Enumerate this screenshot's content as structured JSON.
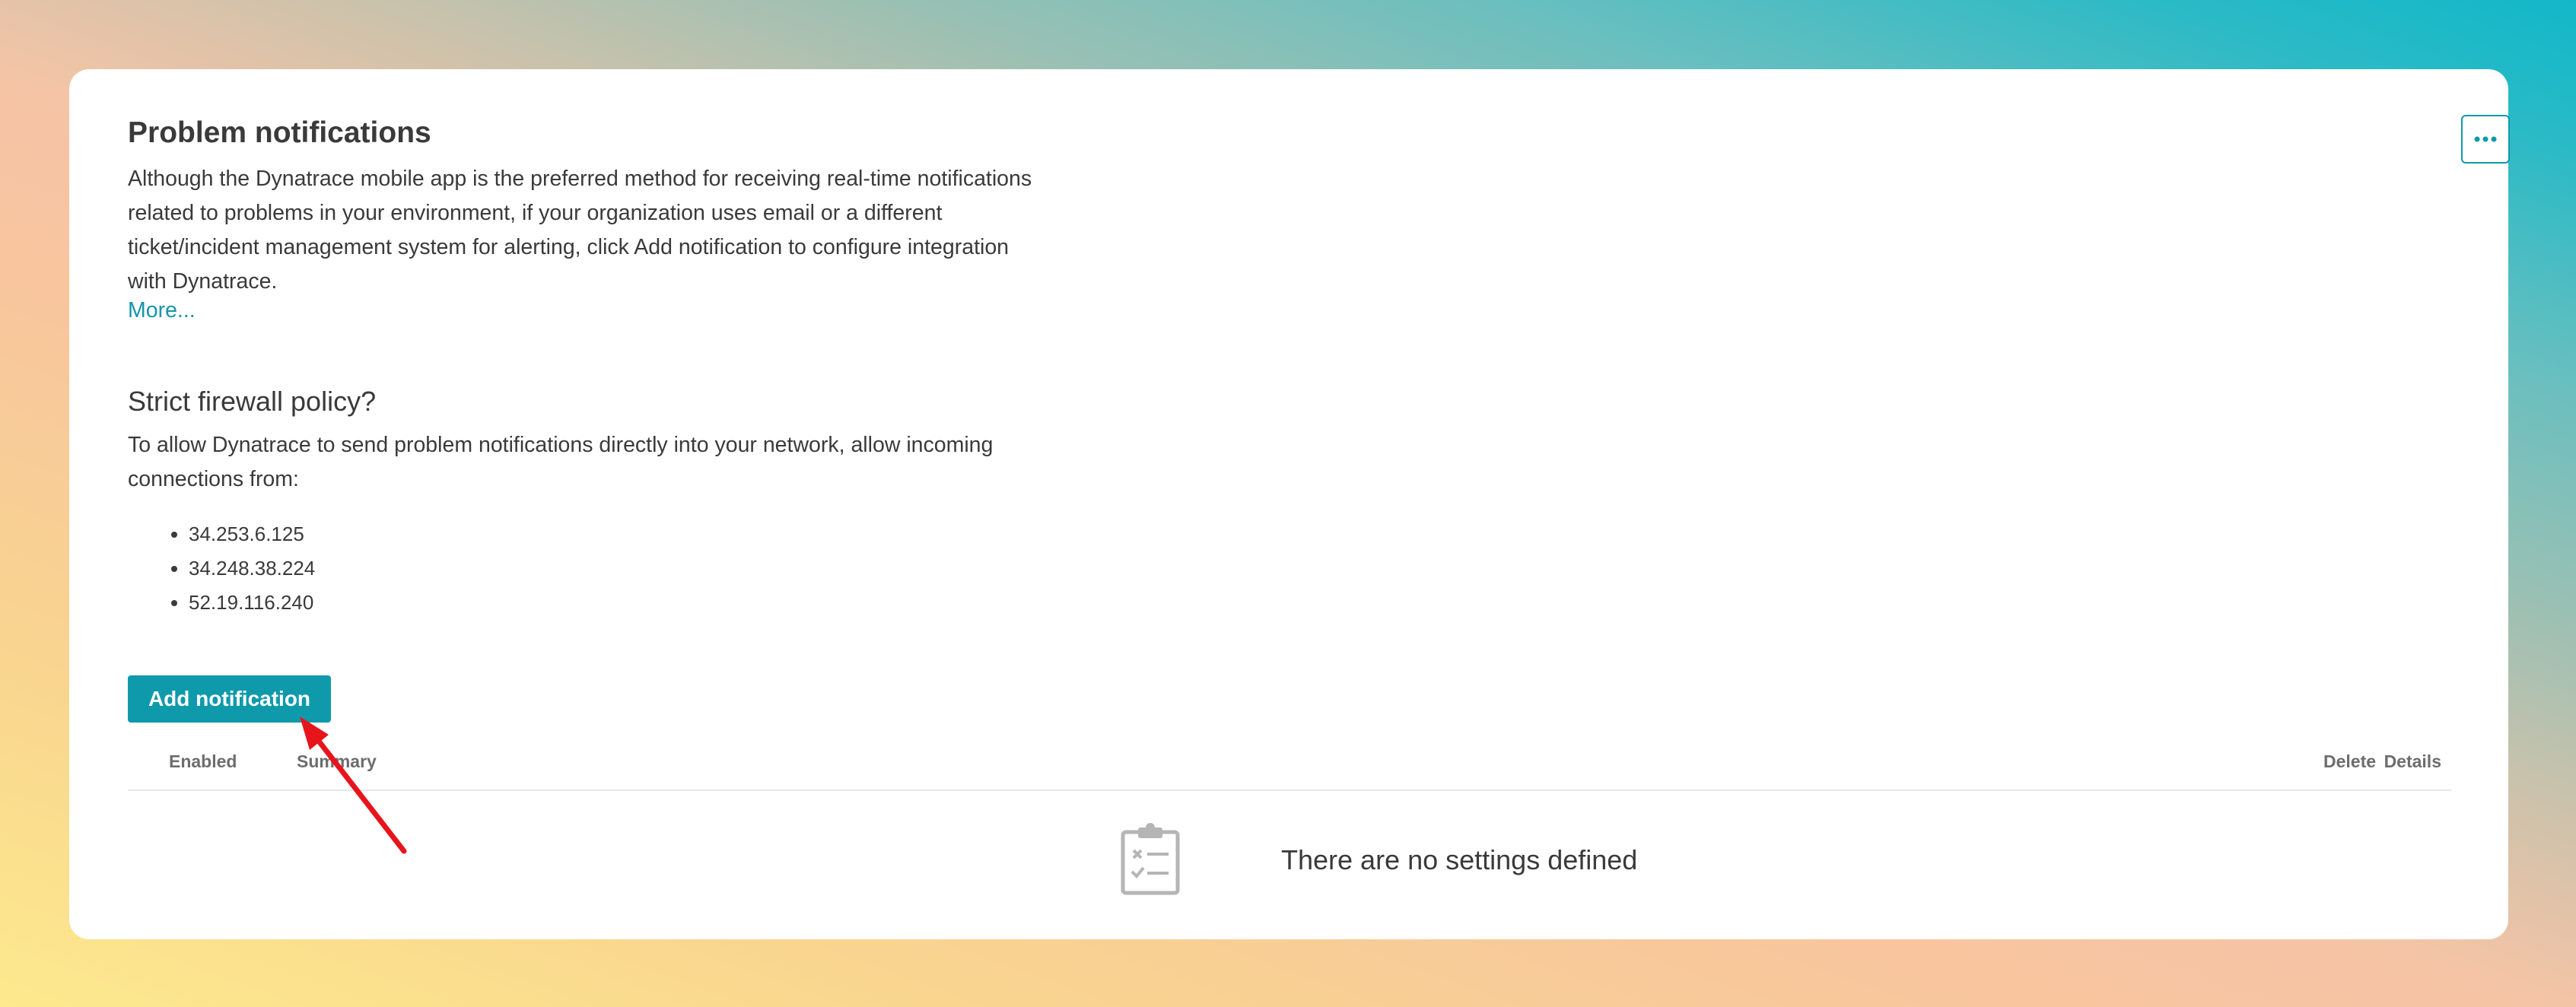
{
  "page": {
    "title": "Problem notifications",
    "intro": "Although the Dynatrace mobile app is the preferred method for receiving real-time notifications related to problems in your environment, if your organization uses email or a different ticket/incident management system for alerting, click Add notification to configure integration with Dynatrace.",
    "more_link": "More..."
  },
  "firewall": {
    "title": "Strict firewall policy?",
    "description": "To allow Dynatrace to send problem notifications directly into your network, allow incoming connections from:",
    "ips": [
      "34.253.6.125",
      "34.248.38.224",
      "52.19.116.240"
    ]
  },
  "actions": {
    "add_notification": "Add notification",
    "more_menu_icon": "ellipsis-icon"
  },
  "table": {
    "columns": {
      "enabled": "Enabled",
      "summary": "Summary",
      "delete": "Delete",
      "details": "Details"
    },
    "empty_text": "There are no settings defined",
    "empty_icon": "clipboard-checklist-icon"
  },
  "colors": {
    "accent": "#0f9aab",
    "link": "#1496a8",
    "text": "#3a3a3a",
    "header_text": "#6d6d6d",
    "annotation_arrow": "#e8141b"
  }
}
